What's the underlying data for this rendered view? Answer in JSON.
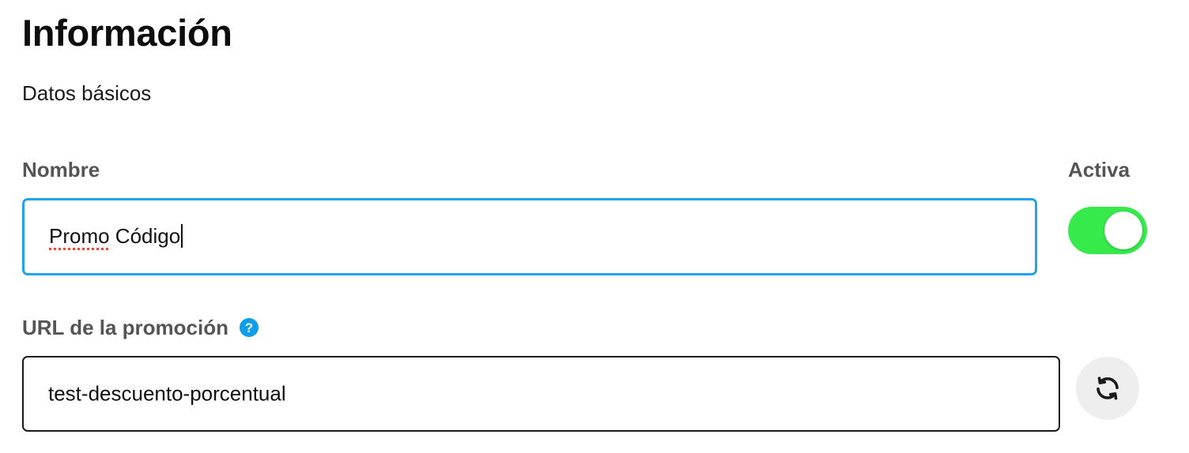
{
  "header": {
    "title": "Información",
    "subtitle": "Datos básicos"
  },
  "form": {
    "name": {
      "label": "Nombre",
      "value_word1": "Promo",
      "value_rest": " Código"
    },
    "active": {
      "label": "Activa",
      "enabled": true,
      "color": "#36ea4b"
    },
    "url": {
      "label": "URL de la promoción",
      "help_glyph": "?",
      "value": "test-descuento-porcentual"
    },
    "refresh_icon": "refresh-icon"
  },
  "colors": {
    "focus_border": "#22a3ef",
    "help_icon": "#0f9ee8",
    "label": "#555555"
  }
}
